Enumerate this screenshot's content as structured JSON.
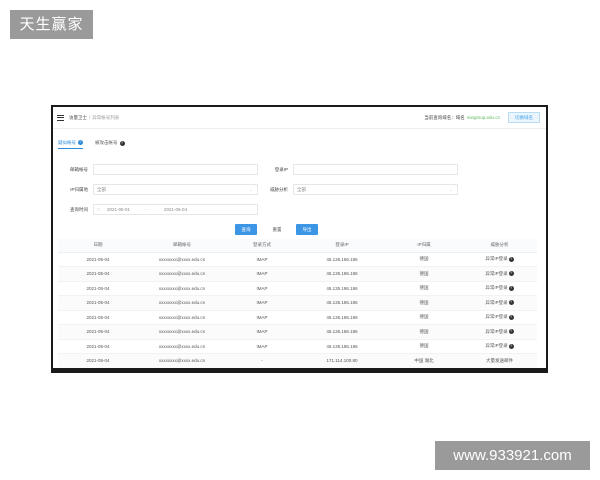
{
  "watermarks": {
    "top": "天生赢家",
    "bottom": "www.933921.com"
  },
  "header": {
    "crumb_root": "访量卫士",
    "crumb_sep": "/",
    "crumb_current": "异常帐号列表",
    "domain_label": "当前查询域名：",
    "domain_value": "域名",
    "domain_extra": "mingmop.edu.cn",
    "switch_button": "切换域名"
  },
  "tabs": [
    {
      "label": "疑似帐号",
      "active": true
    },
    {
      "label": "被攻击帐号",
      "active": false
    }
  ],
  "filters": {
    "mailbox_label": "邮箱帐号",
    "login_ip_label": "登录IP",
    "ip_location_label": "IP归属地",
    "ip_location_value": "全部",
    "threat_label": "威胁分析",
    "threat_value": "全部",
    "query_time_label": "查询时间",
    "date_start": "2021-05-01",
    "date_sep": "-",
    "date_end": "2021-05-04"
  },
  "actions": {
    "query": "查询",
    "reset": "重置",
    "export": "导出"
  },
  "table": {
    "columns": [
      "日期",
      "邮箱帐号",
      "登录方式",
      "登录IP",
      "IP归属",
      "威胁分析"
    ],
    "rows": [
      {
        "date": "2021-05-04",
        "account": "xxxxxxxx@xxxx.edu.cn",
        "method": "IMAP",
        "ip": "45.135.186.186",
        "location": "德国",
        "threat": "异常IP登录"
      },
      {
        "date": "2021-05-04",
        "account": "xxxxxxxx@xxxx.edu.cn",
        "method": "IMAP",
        "ip": "45.135.186.186",
        "location": "德国",
        "threat": "异常IP登录"
      },
      {
        "date": "2021-05-04",
        "account": "xxxxxxxx@xxxx.edu.cn",
        "method": "IMAP",
        "ip": "45.135.186.186",
        "location": "德国",
        "threat": "异常IP登录"
      },
      {
        "date": "2021-05-04",
        "account": "xxxxxxxx@xxxx.edu.cn",
        "method": "IMAP",
        "ip": "45.135.186.186",
        "location": "德国",
        "threat": "异常IP登录"
      },
      {
        "date": "2021-05-04",
        "account": "xxxxxxxx@xxxx.edu.cn",
        "method": "IMAP",
        "ip": "45.135.186.186",
        "location": "德国",
        "threat": "异常IP登录"
      },
      {
        "date": "2021-05-04",
        "account": "xxxxxxxx@xxxx.edu.cn",
        "method": "IMAP",
        "ip": "45.135.186.186",
        "location": "德国",
        "threat": "异常IP登录"
      },
      {
        "date": "2021-05-04",
        "account": "xxxxxxxx@xxxx.edu.cn",
        "method": "IMAP",
        "ip": "45.135.186.186",
        "location": "德国",
        "threat": "异常IP登录"
      },
      {
        "date": "2021-05-04",
        "account": "xxxxxxxx@xxxx.edu.cn",
        "method": "-",
        "ip": "171.114.100.80",
        "location": "中国 湖北",
        "threat": "大量发送邮件"
      }
    ]
  },
  "colors": {
    "accent": "#3d95e6",
    "border": "#1a1a1a",
    "domain_value": "#5cb85c",
    "watermark_bg": "#9a9a9a"
  },
  "icons": {
    "menu": "hamburger-icon",
    "help": "question-circle-icon",
    "calendar": "calendar-icon",
    "dropdown": "chevron-down-icon"
  }
}
